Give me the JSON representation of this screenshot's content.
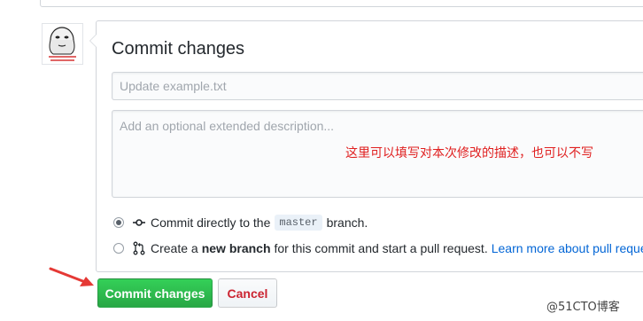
{
  "form": {
    "title": "Commit changes",
    "summary_placeholder": "Update example.txt",
    "description_placeholder": "Add an optional extended description...",
    "annotation": "这里可以填写对本次修改的描述，也可以不写"
  },
  "options": {
    "direct": {
      "checked": true,
      "text_before": "Commit directly to the",
      "branch": "master",
      "text_after": "branch."
    },
    "new_branch": {
      "checked": false,
      "text_before": "Create a",
      "bold": "new branch",
      "text_after": "for this commit and start a pull request.",
      "link": "Learn more about pull reque"
    }
  },
  "buttons": {
    "commit": "Commit changes",
    "cancel": "Cancel"
  },
  "colors": {
    "primary_button": "#28a745",
    "cancel_text": "#cb2431",
    "link": "#0366d6",
    "annotation": "#e02020",
    "arrow": "#e53935"
  },
  "icons": {
    "avatar": "meme-face-avatar",
    "direct": "git-commit-icon",
    "new_branch": "git-pull-request-icon",
    "pointer": "red-arrow-icon"
  },
  "watermark": "@51CTO博客"
}
